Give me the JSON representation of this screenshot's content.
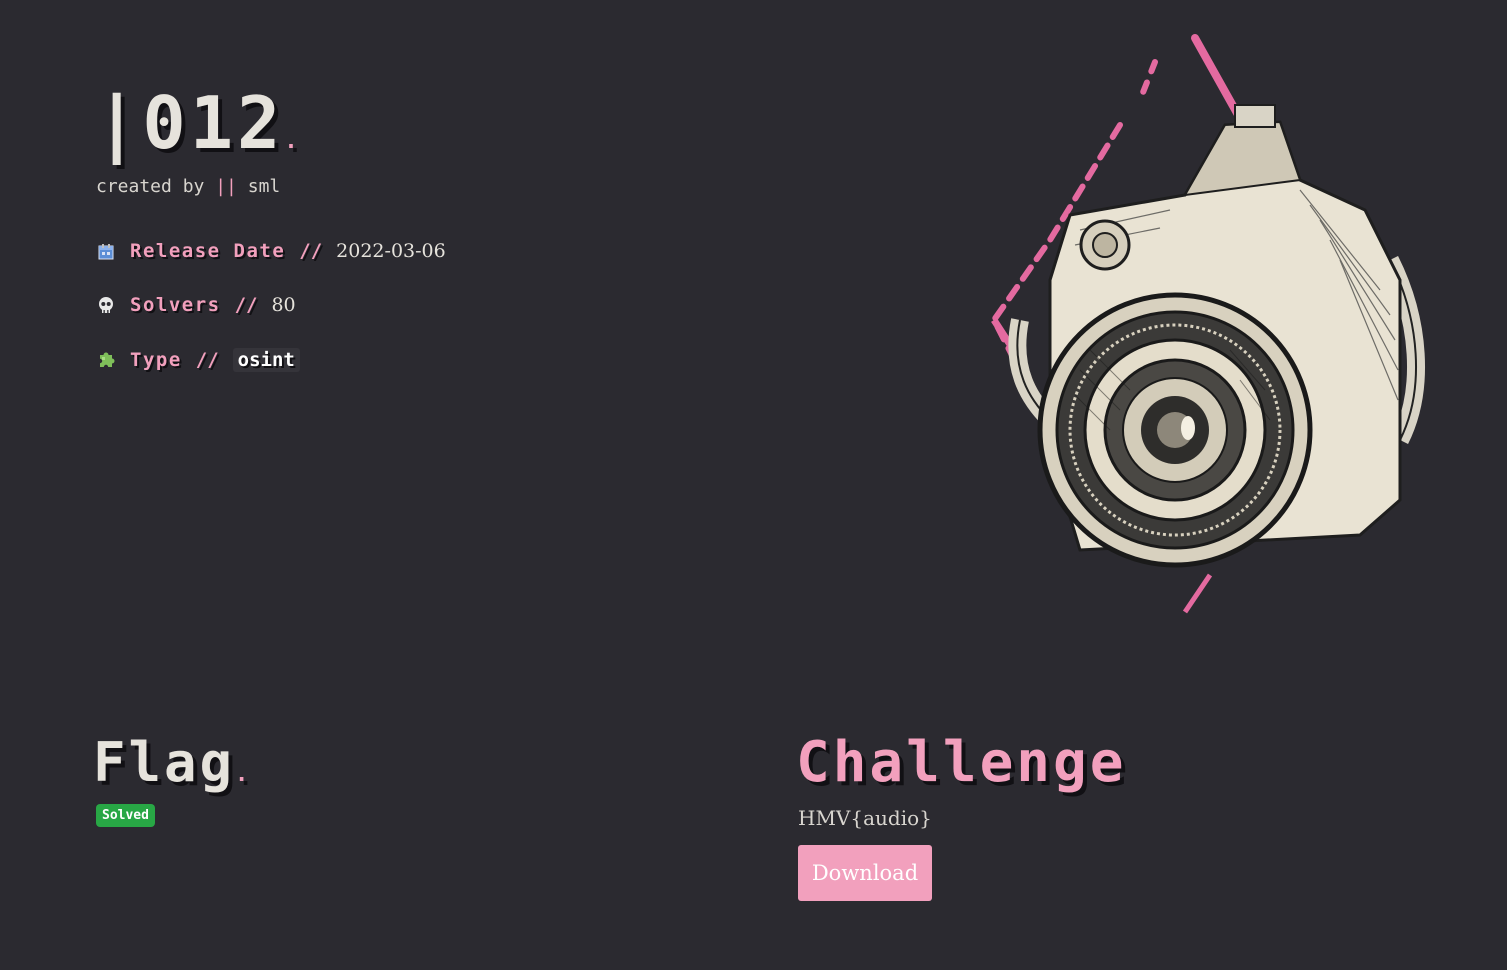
{
  "machine": {
    "title": "|012",
    "title_dot": ".",
    "created_prefix": "created by",
    "created_sep": "||",
    "author": "sml"
  },
  "meta": {
    "release": {
      "icon": "calendar-icon",
      "label": "Release Date",
      "sep": "//",
      "value": "2022-03-06"
    },
    "solvers": {
      "icon": "skull-icon",
      "label": "Solvers",
      "sep": "//",
      "value": "80"
    },
    "type": {
      "icon": "puzzle-icon",
      "label": "Type",
      "sep": "//",
      "value": "osint"
    }
  },
  "flag": {
    "title": "Flag",
    "title_dot": ".",
    "status": "Solved"
  },
  "challenge": {
    "title": "Challenge",
    "flag_text": "HMV{audio}",
    "download_label": "Download"
  },
  "colors": {
    "background": "#2b2a30",
    "accent_pink": "#f2a0bd",
    "solved_green": "#28a745",
    "text": "#e6e3dc"
  }
}
